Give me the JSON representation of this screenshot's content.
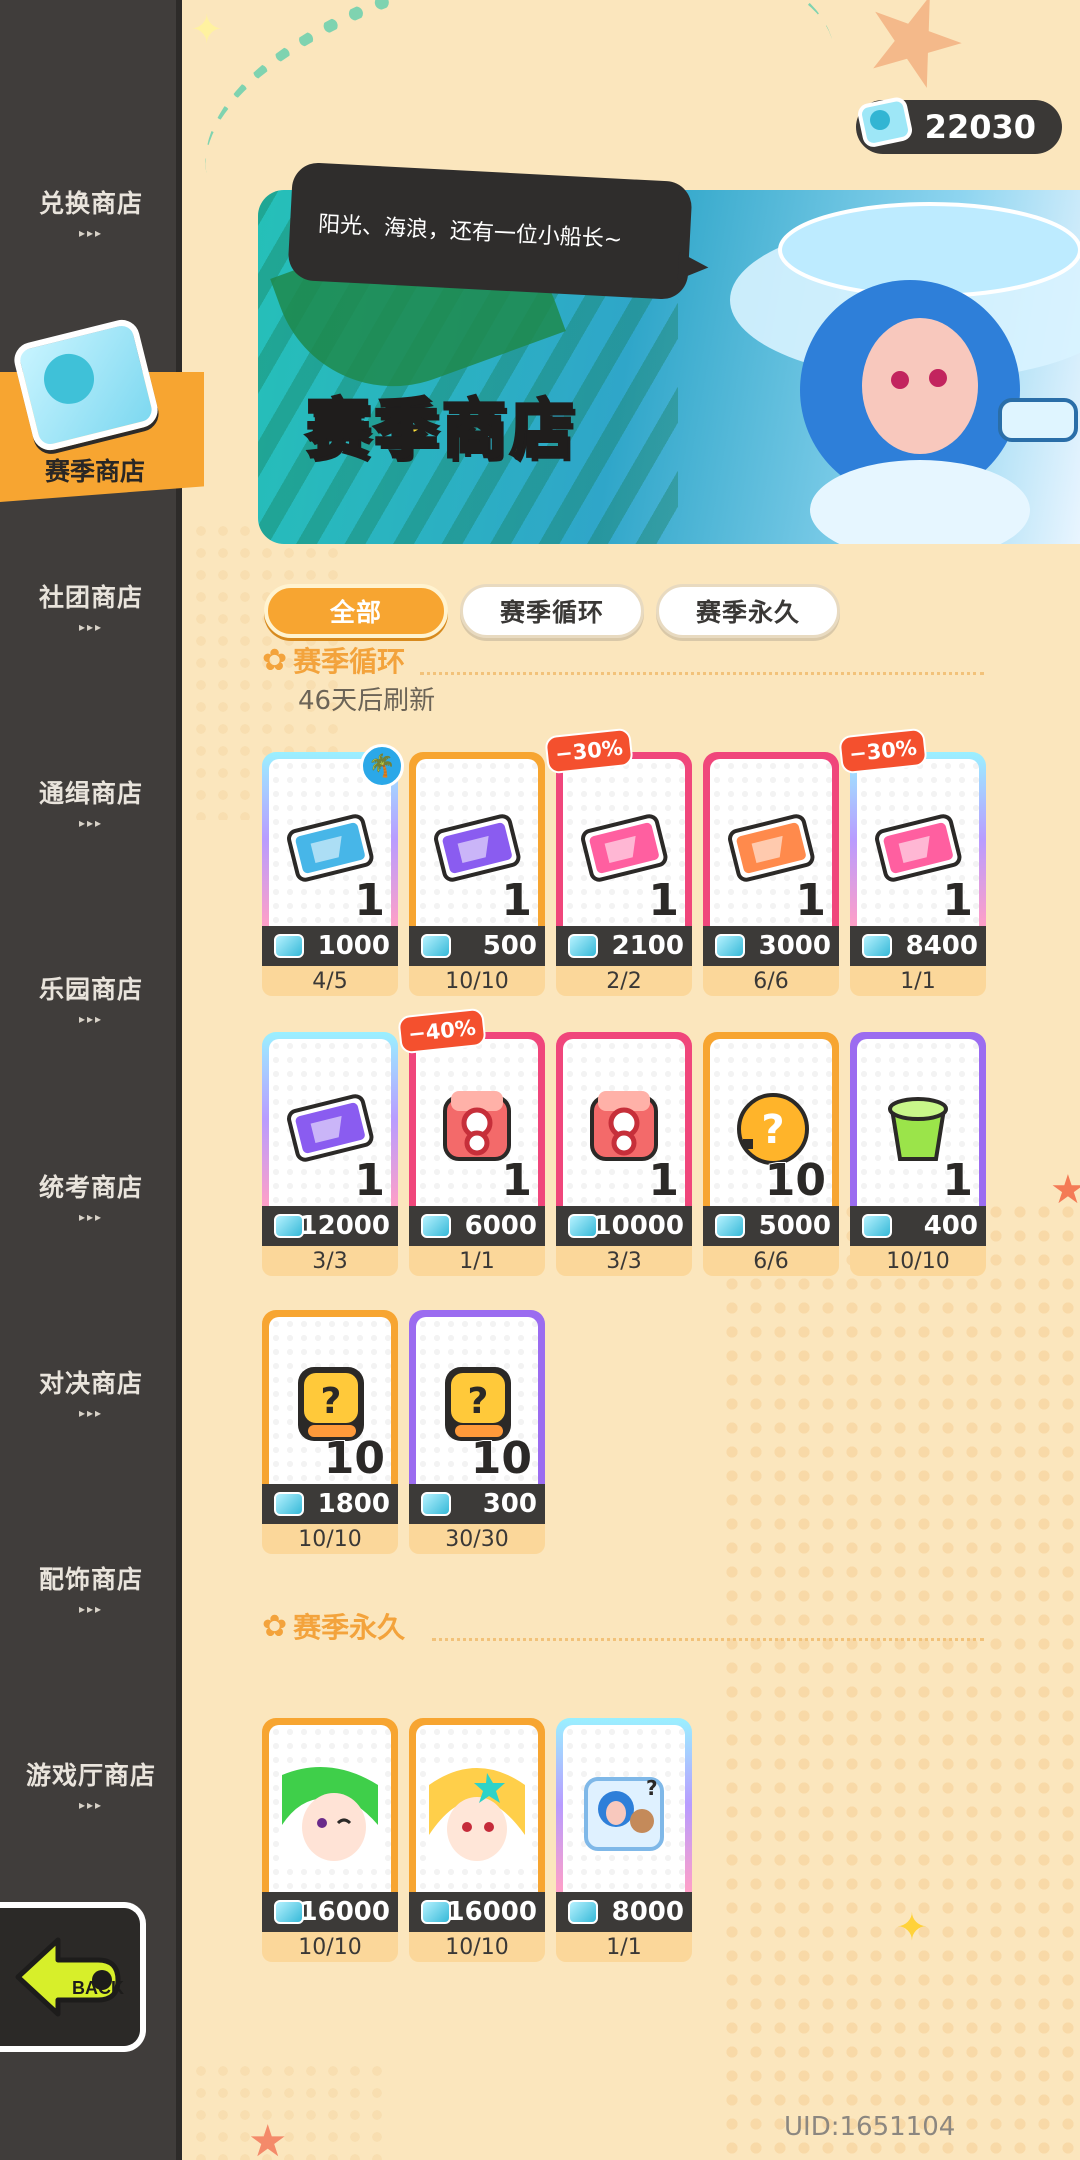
{
  "currency": {
    "amount": "22030",
    "icon": "season-ticket-icon"
  },
  "sidebar": {
    "items": [
      {
        "label": "兑换商店"
      },
      {
        "label": "赛季商店",
        "active": true
      },
      {
        "label": "社团商店"
      },
      {
        "label": "通缉商店"
      },
      {
        "label": "乐园商店"
      },
      {
        "label": "统考商店"
      },
      {
        "label": "对决商店"
      },
      {
        "label": "配饰商店"
      },
      {
        "label": "游戏厅商店"
      }
    ],
    "dots": "▸▸▸",
    "back_label": "BACK"
  },
  "banner": {
    "title": "赛季商店",
    "speech": "阳光、海浪，还有一位小船长~"
  },
  "tabs": [
    {
      "label": "全部",
      "active": true
    },
    {
      "label": "赛季循环",
      "active": false
    },
    {
      "label": "赛季永久",
      "active": false
    }
  ],
  "sections": {
    "cycle": {
      "title": "赛季循环",
      "refresh": "46天后刷新"
    },
    "permanent": {
      "title": "赛季永久"
    }
  },
  "cycle_items": [
    {
      "price": "1000",
      "limit": "4/5",
      "qty": "1",
      "discount": "",
      "frame": "rainbow",
      "icon": "whale-ticket-icon",
      "badge": "palm-badge-icon"
    },
    {
      "price": "500",
      "limit": "10/10",
      "qty": "1",
      "discount": "",
      "frame": "orange",
      "icon": "purple-ticket-icon"
    },
    {
      "price": "2100",
      "limit": "2/2",
      "qty": "1",
      "discount": "−30%",
      "frame": "pink",
      "icon": "pink-ticket-icon"
    },
    {
      "price": "3000",
      "limit": "6/6",
      "qty": "1",
      "discount": "",
      "frame": "pink",
      "icon": "orange-ticket-icon"
    },
    {
      "price": "8400",
      "limit": "1/1",
      "qty": "1",
      "discount": "−30%",
      "frame": "rainbow",
      "icon": "pink-ticket-icon"
    },
    {
      "price": "12000",
      "limit": "3/3",
      "qty": "1",
      "discount": "",
      "frame": "rainbow",
      "icon": "purple-ticket-icon"
    },
    {
      "price": "6000",
      "limit": "1/1",
      "qty": "1",
      "discount": "−40%",
      "frame": "pink",
      "icon": "red-dice-icon"
    },
    {
      "price": "10000",
      "limit": "3/3",
      "qty": "1",
      "discount": "",
      "frame": "pink",
      "icon": "red-dice-icon"
    },
    {
      "price": "5000",
      "limit": "6/6",
      "qty": "10",
      "discount": "",
      "frame": "orange",
      "icon": "mystery-egg-icon"
    },
    {
      "price": "400",
      "limit": "10/10",
      "qty": "1",
      "discount": "",
      "frame": "purple",
      "icon": "green-jelly-icon"
    },
    {
      "price": "1800",
      "limit": "10/10",
      "qty": "10",
      "discount": "",
      "frame": "orange",
      "icon": "mystery-fragment-icon"
    },
    {
      "price": "300",
      "limit": "30/30",
      "qty": "10",
      "discount": "",
      "frame": "purple",
      "icon": "mystery-fragment-icon"
    }
  ],
  "permanent_items": [
    {
      "price": "16000",
      "limit": "10/10",
      "frame": "orange",
      "icon": "green-hair-avatar-icon"
    },
    {
      "price": "16000",
      "limit": "10/10",
      "frame": "orange",
      "icon": "blonde-avatar-icon"
    },
    {
      "price": "8000",
      "limit": "1/1",
      "frame": "rainbow",
      "icon": "captain-frame-icon"
    }
  ],
  "uid": "UID:1651104",
  "colors": {
    "accent": "#f7a531",
    "sidebar": "#403d3b",
    "background": "#fbe6bd",
    "discount": "#f4502e"
  }
}
